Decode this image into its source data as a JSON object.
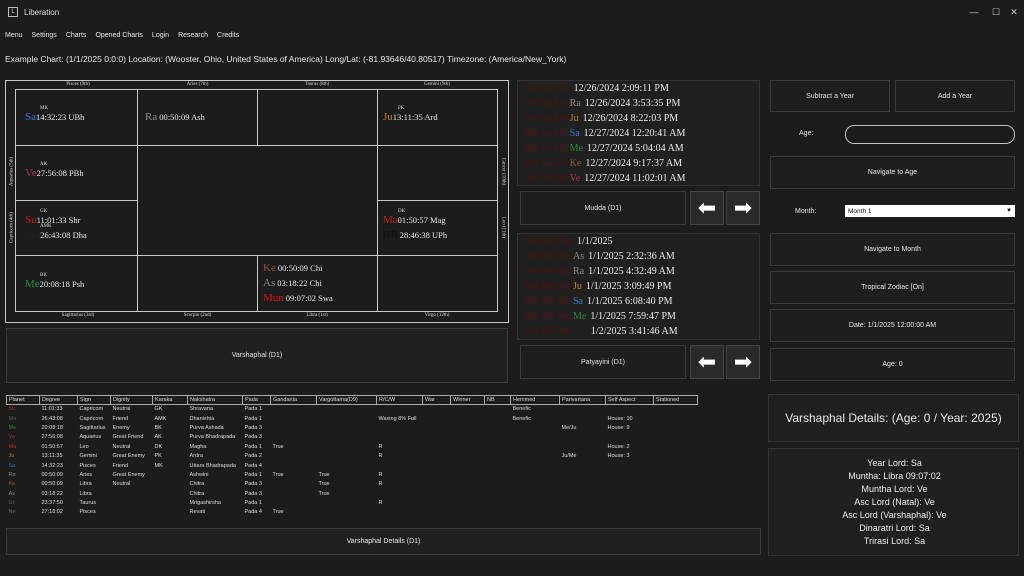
{
  "window": {
    "title": "Liberation",
    "controls": {
      "minimize": "—",
      "maximize": "☐",
      "close": "✕"
    }
  },
  "menu": [
    "Menu",
    "Settings",
    "Charts",
    "Opened Charts",
    "Login",
    "Research",
    "Credits"
  ],
  "chart_info": "Example Chart: (1/1/2025 0:0:0) Location: (Wooster, Ohio, United States of America) Long/Lat: (-81.93646/40.80517) Timezone: (America/New_York)",
  "signs": {
    "top": [
      "Pisces (9th)",
      "Aries (7th)",
      "Taurus (8th)",
      "Gemini (9th)"
    ],
    "bottom": [
      "Sagittarius (3rd)",
      "Scorpio (2nd)",
      "Libra (1st)",
      "Virgo (12th)"
    ],
    "left": [
      "Aquarius (5th)",
      "Capricorn (4th)"
    ],
    "right": [
      "Cancer (10th)",
      "Leo (11th)"
    ]
  },
  "planets": [
    {
      "abbr": "Sa",
      "karaka": "MK",
      "time": "14:32:23 UBh",
      "color": "sa"
    },
    {
      "abbr": "Ra",
      "karaka": "",
      "time": "00:50:09 Ash",
      "color": "ra"
    },
    {
      "abbr": "Ju",
      "karaka": "PK",
      "time": "13:11:35 Ard",
      "color": "ju"
    },
    {
      "abbr": "Ve",
      "karaka": "AK",
      "time": "27:56:08 PBh",
      "color": "ve"
    },
    {
      "abbr": "Su",
      "karaka": "GK",
      "time": "11:01:33 Shr",
      "color": "su"
    },
    {
      "abbr": "Mo",
      "karaka": "AMK",
      "time": "26:43:08 Dha",
      "color": "mo"
    },
    {
      "abbr": "Ma",
      "karaka": "DK",
      "time": "01:50:57 Mag",
      "color": "ma"
    },
    {
      "abbr": "BB",
      "karaka": "",
      "time": "28:46:38 UPh",
      "color": "bb"
    },
    {
      "abbr": "Me",
      "karaka": "BK",
      "time": "20:08:18 Psh",
      "color": "mec"
    },
    {
      "abbr": "Ke",
      "karaka": "",
      "time": "00:50:09 Chi",
      "color": "ke"
    },
    {
      "abbr": "As",
      "karaka": "",
      "time": "03:18:22 Chi",
      "color": "as"
    },
    {
      "abbr": "Mun",
      "karaka": "",
      "time": "09:07:02 Swa",
      "color": "mun"
    }
  ],
  "varshaphal_button": "Varshaphal (D1)",
  "mudda": {
    "rows": [
      {
        "l1": "Me Sa Me",
        "l2": "",
        "date": "12/26/2024 2:09:11 PM"
      },
      {
        "l1": "Me Sa Me",
        "l2": "Ra",
        "date": "12/26/2024 3:53:35 PM"
      },
      {
        "l1": "Me Sa Me",
        "l2": "Ju",
        "date": "12/26/2024 8:22:03 PM"
      },
      {
        "l1": "Me Sa Me",
        "l2": "Sa",
        "date": "12/27/2024 12:20:41 AM"
      },
      {
        "l1": "Me Sa Me",
        "l2": "Me",
        "date": "12/27/2024 5:04:04 AM"
      },
      {
        "l1": "Me Sa Me",
        "l2": "Ke",
        "date": "12/27/2024 9:17:37 AM"
      },
      {
        "l1": "Me Sa Me",
        "l2": "Ve",
        "date": "12/27/2024 11:02:01 AM"
      }
    ],
    "button": "Mudda (D1)"
  },
  "patyayini": {
    "rows": [
      {
        "l1": "Me Me Me",
        "l2": "",
        "date": "1/1/2025"
      },
      {
        "l1": "Me Me Me",
        "l2": "As",
        "date": "1/1/2025 2:32:36 AM"
      },
      {
        "l1": "Me Me Me",
        "l2": "Ra",
        "date": "1/1/2025 4:32:49 AM"
      },
      {
        "l1": "Me Me Me",
        "l2": "Ju",
        "date": "1/1/2025 3:09:49 PM"
      },
      {
        "l1": "Me Me Me",
        "l2": "Sa",
        "date": "1/1/2025 6:08:40 PM"
      },
      {
        "l1": "Me Me Me",
        "l2": "Me",
        "date": "1/1/2025 7:59:47 PM"
      },
      {
        "l1": "Me Me Me",
        "l2": "Mo",
        "date": "1/2/2025 3:41:46 AM"
      }
    ],
    "button": "Patyayini (D1)"
  },
  "arrows": {
    "left": "⬅",
    "right": "➡"
  },
  "controls": {
    "subtract_year": "Subtract a Year",
    "add_year": "Add a Year",
    "age_label": "Age:",
    "age_value": "",
    "navigate_age": "Navigate to Age",
    "month_label": "Month:",
    "month_value": "Month 1",
    "navigate_month": "Navigate to Month",
    "tropical": "Tropical Zodiac [On]",
    "date": "Date: 1/1/2025 12:00:00 AM",
    "age": "Age: 0"
  },
  "table": {
    "headers": [
      "Planet",
      "Degree",
      "Sign",
      "Dignity",
      "Karaka",
      "Nakshatra",
      "Pada",
      "Gandanta",
      "Vargottama(D9)",
      "R/C/W",
      "War",
      "Winner",
      "NB",
      "Hemmed",
      "Parivartana",
      "Self Aspect",
      "Stationed"
    ],
    "rows": [
      [
        "Su",
        "11:01:33",
        "Capricorn",
        "Neutral",
        "GK",
        "Shravana",
        "Pada 1",
        "",
        "",
        "",
        "",
        "",
        "",
        "Benefic",
        "",
        "",
        ""
      ],
      [
        "Mo",
        "26:43:08",
        "Capricorn",
        "Friend",
        "AMK",
        "Dhanishta",
        "Pada 1",
        "",
        "",
        "Waxing 8% Full",
        "",
        "",
        "",
        "Benefic",
        "",
        "House: 10",
        ""
      ],
      [
        "Me",
        "20:08:18",
        "Sagittarius",
        "Enemy",
        "BK",
        "Purva Ashada",
        "Pada 3",
        "",
        "",
        "",
        "",
        "",
        "",
        "",
        "Me/Ju",
        "House: 9",
        ""
      ],
      [
        "Ve",
        "27:56:08",
        "Aquarius",
        "Great Friend",
        "AK",
        "Purva Bhadrapada",
        "Pada 3",
        "",
        "",
        "",
        "",
        "",
        "",
        "",
        "",
        "",
        ""
      ],
      [
        "Ma",
        "01:50:57",
        "Leo",
        "Neutral",
        "DK",
        "Magha",
        "Pada 1",
        "True",
        "",
        "R",
        "",
        "",
        "",
        "",
        "",
        "House: 2",
        ""
      ],
      [
        "Ju",
        "13:11:35",
        "Gemini",
        "Great Enemy",
        "PK",
        "Ardra",
        "Pada 2",
        "",
        "",
        "R",
        "",
        "",
        "",
        "",
        "Ju/Me",
        "House: 3",
        ""
      ],
      [
        "Sa",
        "14:32:23",
        "Pisces",
        "Friend",
        "MK",
        "Uttara Bhadrapada",
        "Pada 4",
        "",
        "",
        "",
        "",
        "",
        "",
        "",
        "",
        "",
        ""
      ],
      [
        "Ra",
        "00:50:09",
        "Aries",
        "Great Enemy",
        "",
        "Ashwini",
        "Pada 1",
        "True",
        "True",
        "R",
        "",
        "",
        "",
        "",
        "",
        "",
        ""
      ],
      [
        "Ke",
        "00:50:09",
        "Libra",
        "Neutral",
        "",
        "Chitra",
        "Pada 3",
        "",
        "True",
        "R",
        "",
        "",
        "",
        "",
        "",
        "",
        ""
      ],
      [
        "As",
        "03:18:22",
        "Libra",
        "",
        "",
        "Chitra",
        "Pada 3",
        "",
        "True",
        "",
        "",
        "",
        "",
        "",
        "",
        "",
        ""
      ],
      [
        "Ur",
        "23:37:50",
        "Taurus",
        "",
        "",
        "Mrigashirsha",
        "Pada 1",
        "",
        "",
        "R",
        "",
        "",
        "",
        "",
        "",
        "",
        ""
      ],
      [
        "Ne",
        "27:18:02",
        "Pisces",
        "",
        "",
        "Revati",
        "Pada 4",
        "True",
        "",
        "",
        "",
        "",
        "",
        "",
        "",
        "",
        ""
      ]
    ]
  },
  "table_colors": [
    "#c02020",
    "#555555",
    "#2a8a3a",
    "#b03050",
    "#c02020",
    "#c87a1a",
    "#3a78d0",
    "#8a8a8a",
    "#8a5a3a",
    "#8a8a8a",
    "#666666",
    "#666666"
  ],
  "details_button": "Varshaphal Details (D1)",
  "details": {
    "title": "Varshaphal Details: (Age: 0 / Year: 2025)",
    "lines": [
      "Year Lord: Sa",
      "Muntha: Libra 09:07:02",
      "Muntha Lord: Ve",
      "Asc Lord (Natal): Ve",
      "Asc Lord (Varshaphal): Ve",
      "Dinaratri Lord: Sa",
      "Trirasi Lord: Sa"
    ]
  }
}
